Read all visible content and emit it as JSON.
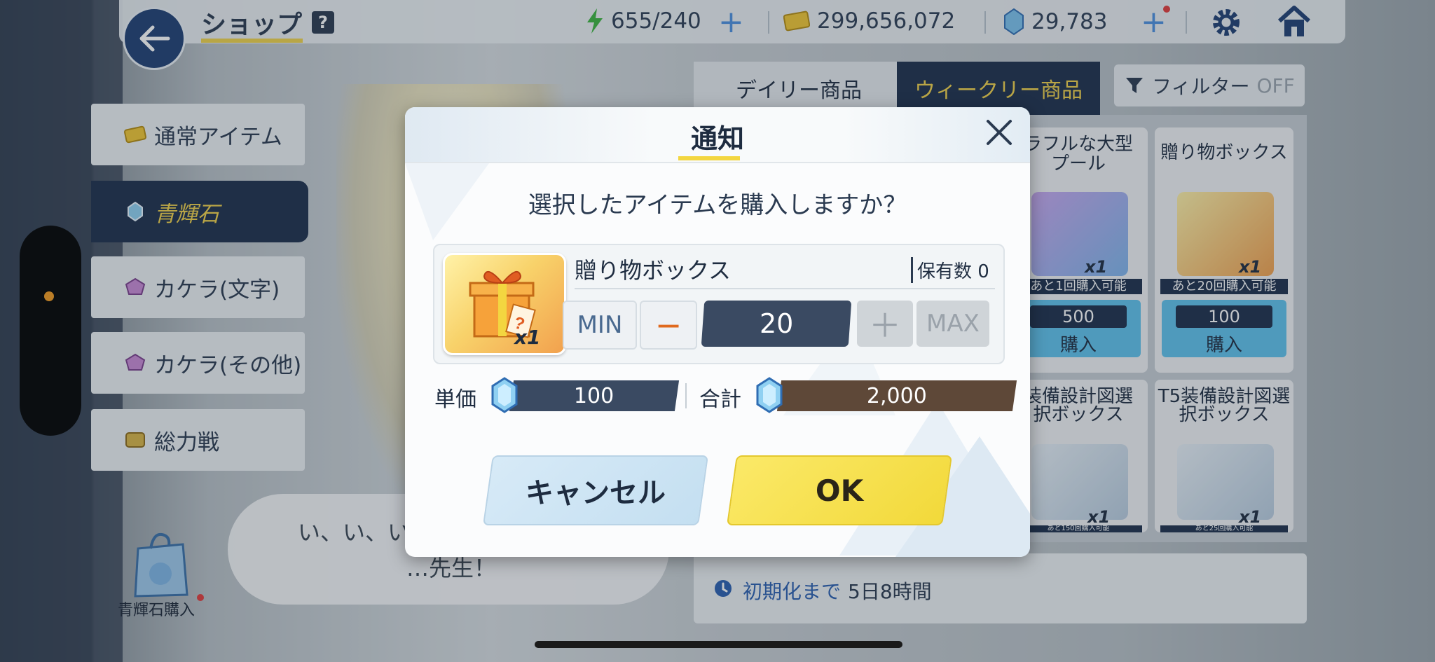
{
  "header": {
    "title": "ショップ",
    "help": "?",
    "stamina": "655/240",
    "credits": "299,656,072",
    "gems": "29,783"
  },
  "sidebar": {
    "items": [
      {
        "label": "通常アイテム",
        "icon": "ticket-icon"
      },
      {
        "label": "青輝石",
        "icon": "pyroxene-icon"
      },
      {
        "label": "カケラ(文字)",
        "icon": "eleph-icon"
      },
      {
        "label": "カケラ(その他)",
        "icon": "eleph-icon"
      },
      {
        "label": "総力戦",
        "icon": "coin-icon"
      }
    ]
  },
  "tabs": {
    "daily": "デイリー商品",
    "weekly": "ウィークリー商品",
    "filter": "フィルター",
    "filter_state": "OFF"
  },
  "cards": [
    {
      "name_line1": "ラフルな大型",
      "name_line2": "プール",
      "qty": "x1",
      "remain": "あと1回購入可能",
      "price": "500",
      "buy": "購入"
    },
    {
      "name_line1": "贈り物ボックス",
      "name_line2": "",
      "qty": "x1",
      "remain": "あと20回購入可能",
      "price": "100",
      "buy": "購入"
    },
    {
      "name_line1": "装備設計図選",
      "name_line2": "択ボックス",
      "qty": "x1",
      "remain": "あと150回購入可能"
    },
    {
      "name_line1": "T5装備設計図選",
      "name_line2": "択ボックス",
      "qty": "x1",
      "remain": "あと25回購入可能"
    }
  ],
  "reset": {
    "label": "初期化まで",
    "value": "5日8時間"
  },
  "speech": {
    "line1": "い、い、い",
    "line2": "…先生！"
  },
  "bag": {
    "label": "青輝石購入"
  },
  "dialog": {
    "title": "通知",
    "question": "選択したアイテムを購入しますか？",
    "item_name": "贈り物ボックス",
    "item_qty": "x1",
    "owned": "保有数 0",
    "min": "MIN",
    "minus": "−",
    "quantity": "20",
    "plus": "＋",
    "max": "MAX",
    "unit_label": "単価",
    "unit_price": "100",
    "total_label": "合計",
    "total_price": "2,000",
    "cancel": "キャンセル",
    "ok": "OK"
  },
  "colors": {
    "navy": "#1c2e4b",
    "gold": "#f2d24a",
    "ok_yellow": "#f2d93a",
    "cancel_blue": "#c4dff1"
  }
}
